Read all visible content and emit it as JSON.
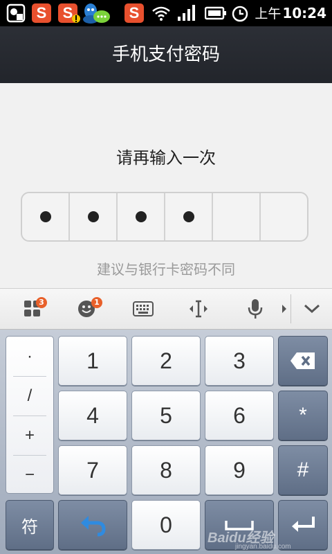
{
  "status_bar": {
    "sogou_letter": "S",
    "time_ampm": "上午",
    "time": "10:24",
    "icons": [
      "record-icon",
      "sogou-icon",
      "sogou-alert-icon",
      "qq-icon",
      "wechat-icon",
      "sogou-icon",
      "wifi-icon",
      "signal-icon",
      "battery-icon",
      "alarm-icon"
    ]
  },
  "title_bar": {
    "title": "手机支付密码"
  },
  "password": {
    "prompt": "请再输入一次",
    "filled": 4,
    "length": 6,
    "hint": "建议与银行卡密码不同"
  },
  "ime_toolbar": {
    "apps_badge": "3",
    "emoji_badge": "1",
    "icons": [
      "apps-grid-icon",
      "emoji-icon",
      "keyboard-icon",
      "cursor-icon",
      "microphone-icon",
      "more-arrow-icon",
      "collapse-icon"
    ]
  },
  "keyboard": {
    "symbols": [
      "·",
      "/",
      "+",
      "−"
    ],
    "digits": [
      "1",
      "2",
      "3",
      "4",
      "5",
      "6",
      "7",
      "8",
      "9",
      "0"
    ],
    "star": "*",
    "hash": "#",
    "fu": "符",
    "icons": [
      "backspace-icon",
      "return-icon",
      "space-icon",
      "enter-icon"
    ]
  },
  "watermark": {
    "text": "Baidu经验",
    "url": "jingyan.baidu.com"
  },
  "colors": {
    "title_bg": "#262930",
    "accent": "#e8502e",
    "fn_key": "#6b7a92",
    "return_arrow": "#2f8be0"
  }
}
